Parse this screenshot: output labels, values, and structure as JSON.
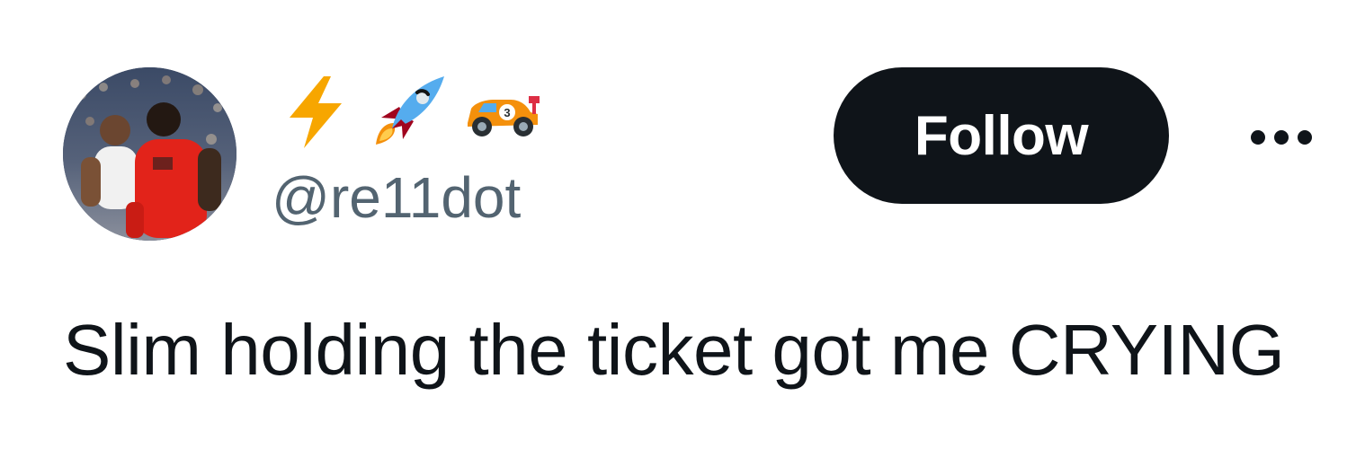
{
  "author": {
    "display_name_emojis": [
      "high-voltage-emoji",
      "rocket-emoji",
      "racing-car-emoji"
    ],
    "handle": "@re11dot",
    "avatar_alt": "avatar"
  },
  "actions": {
    "follow_label": "Follow",
    "more_icon": "more-horizontal-icon"
  },
  "tweet": {
    "text": "Slim holding the ticket got me CRYING"
  },
  "colors": {
    "text_primary": "#0f1419",
    "text_secondary": "#536471",
    "follow_bg": "#0f1419",
    "follow_text": "#ffffff",
    "background": "#ffffff"
  }
}
